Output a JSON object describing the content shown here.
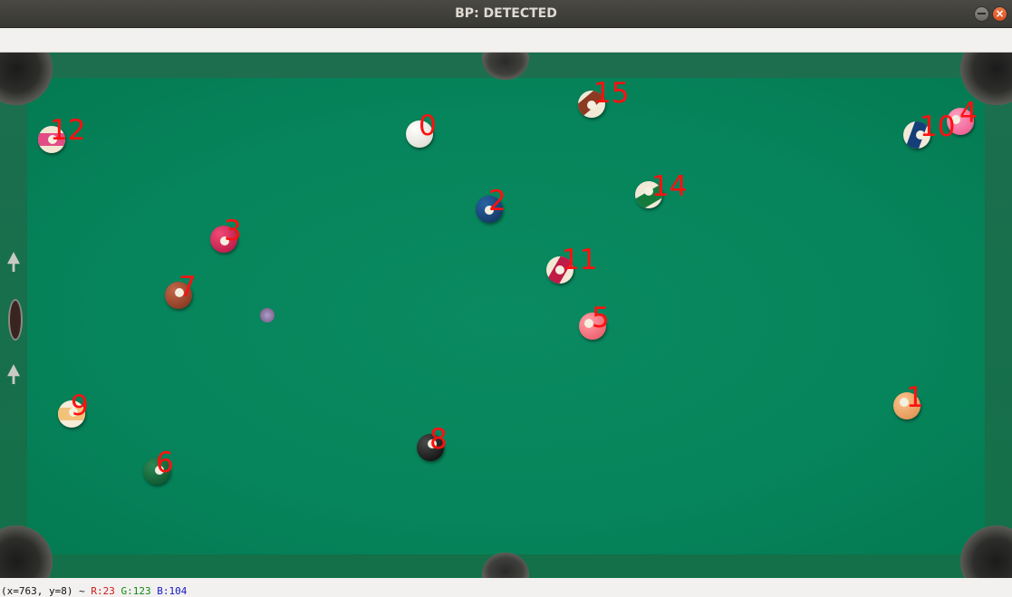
{
  "window": {
    "title": "BP: DETECTED"
  },
  "status": {
    "coords": "(x=763, y=8)",
    "sep": "~",
    "r_label": "R:23",
    "g_label": "G:123",
    "b_label": "B:104"
  },
  "table": {
    "balls": [
      {
        "label": "0",
        "kind": "cue",
        "color": "#f4f1ea"
      },
      {
        "label": "1",
        "kind": "solid",
        "color": "#e89a58"
      },
      {
        "label": "2",
        "kind": "solid",
        "color": "#123f73"
      },
      {
        "label": "3",
        "kind": "solid",
        "color": "#d11a4f"
      },
      {
        "label": "4",
        "kind": "solid",
        "color": "#f06a9a"
      },
      {
        "label": "5",
        "kind": "solid",
        "color": "#ef6f78"
      },
      {
        "label": "6",
        "kind": "solid",
        "color": "#0e5e34"
      },
      {
        "label": "7",
        "kind": "solid",
        "color": "#8c3a22"
      },
      {
        "label": "8",
        "kind": "solid",
        "color": "#121212"
      },
      {
        "label": "9",
        "kind": "stripe",
        "color": "#f2c27a"
      },
      {
        "label": "10",
        "kind": "stripe",
        "color": "#153f78"
      },
      {
        "label": "11",
        "kind": "stripe",
        "color": "#c01a47"
      },
      {
        "label": "12",
        "kind": "stripe",
        "color": "#e24b86"
      },
      {
        "label": "14",
        "kind": "stripe",
        "color": "#137a3c"
      },
      {
        "label": "15",
        "kind": "stripe",
        "color": "#8c3a22"
      }
    ]
  }
}
